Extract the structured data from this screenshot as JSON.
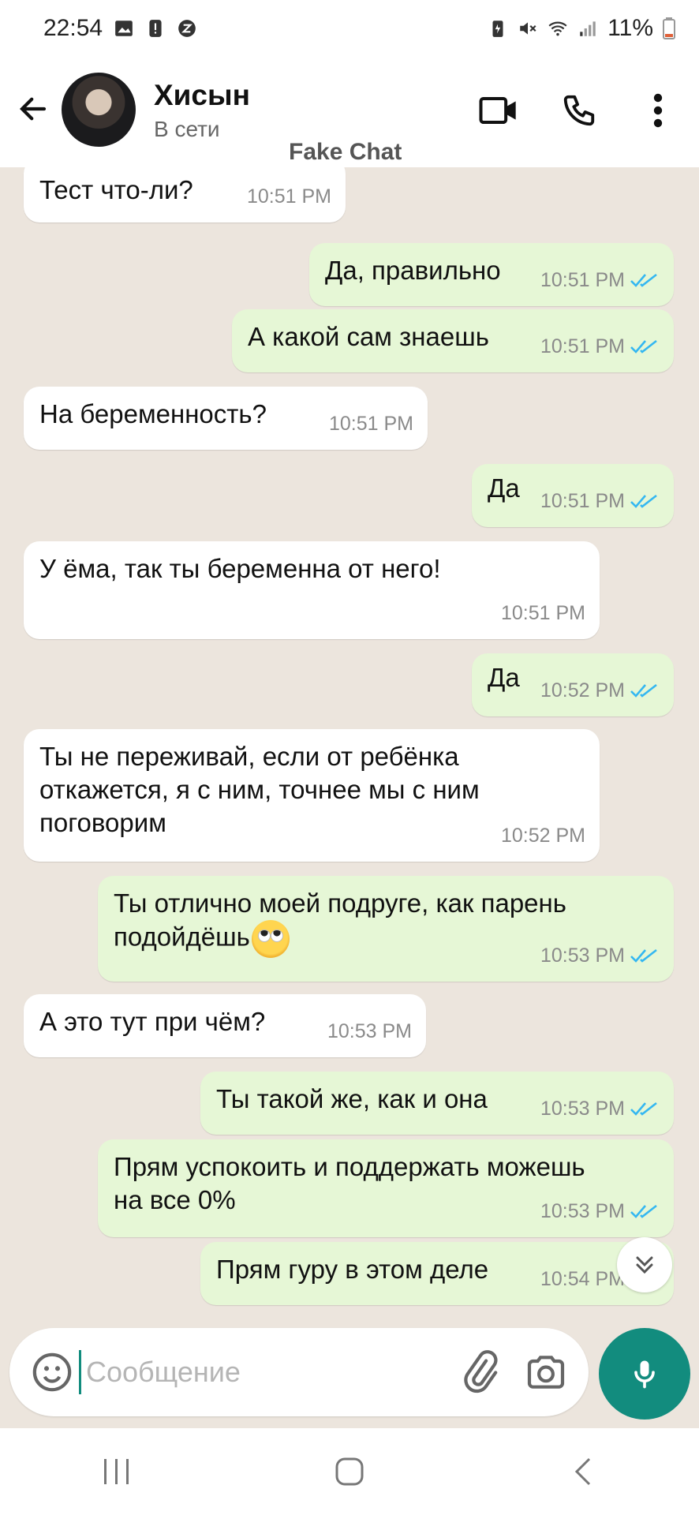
{
  "status_bar": {
    "time": "22:54",
    "battery": "11%"
  },
  "header": {
    "contact_name": "Хисын",
    "contact_status": "В сети",
    "watermark": "Fake Chat"
  },
  "messages": [
    {
      "dir": "in",
      "text": "Тест что-ли?",
      "time": "10:51 PM"
    },
    {
      "dir": "out",
      "text": "Да, правильно",
      "time": "10:51 PM"
    },
    {
      "dir": "out",
      "text": "А какой сам знаешь",
      "time": "10:51 PM"
    },
    {
      "dir": "in",
      "text": "На беременность?",
      "time": "10:51 PM"
    },
    {
      "dir": "out",
      "text": "Да",
      "time": "10:51 PM"
    },
    {
      "dir": "in",
      "text": "У ёма, так ты беременна от него!",
      "time": "10:51 PM"
    },
    {
      "dir": "out",
      "text": "Да",
      "time": "10:52 PM"
    },
    {
      "dir": "in",
      "text_lines": [
        "Ты не переживай, если от ребёнка",
        "откажется, я с ним, точнее мы с ним",
        "поговорим"
      ],
      "time": "10:52 PM"
    },
    {
      "dir": "out",
      "text_lines": [
        "Ты отлично моей подруге, как парень",
        "подойдёшь"
      ],
      "emoji": "face-with-rolling-eyes",
      "time": "10:53 PM"
    },
    {
      "dir": "in",
      "text": "А это тут при чём?",
      "time": "10:53 PM"
    },
    {
      "dir": "out",
      "text": "Ты такой же, как и она",
      "time": "10:53 PM"
    },
    {
      "dir": "out",
      "text_lines": [
        "Прям успокоить и поддержать можешь",
        "на все 0%"
      ],
      "time": "10:53 PM"
    },
    {
      "dir": "out",
      "text": "Прям гуру в этом деле",
      "time": "10:54 PM"
    }
  ],
  "composer": {
    "placeholder": "Сообщение"
  },
  "colors": {
    "chat_bg": "#ece5dd",
    "incoming_bubble": "#ffffff",
    "outgoing_bubble": "#e6f7d6",
    "accent": "#128c7e",
    "read_tick": "#34b7f1"
  },
  "icons": [
    "back-arrow-icon",
    "video-call-icon",
    "phone-icon",
    "more-vert-icon",
    "emoji-icon",
    "attach-icon",
    "camera-icon",
    "mic-icon",
    "double-chevron-down-icon",
    "double-check-icon"
  ]
}
